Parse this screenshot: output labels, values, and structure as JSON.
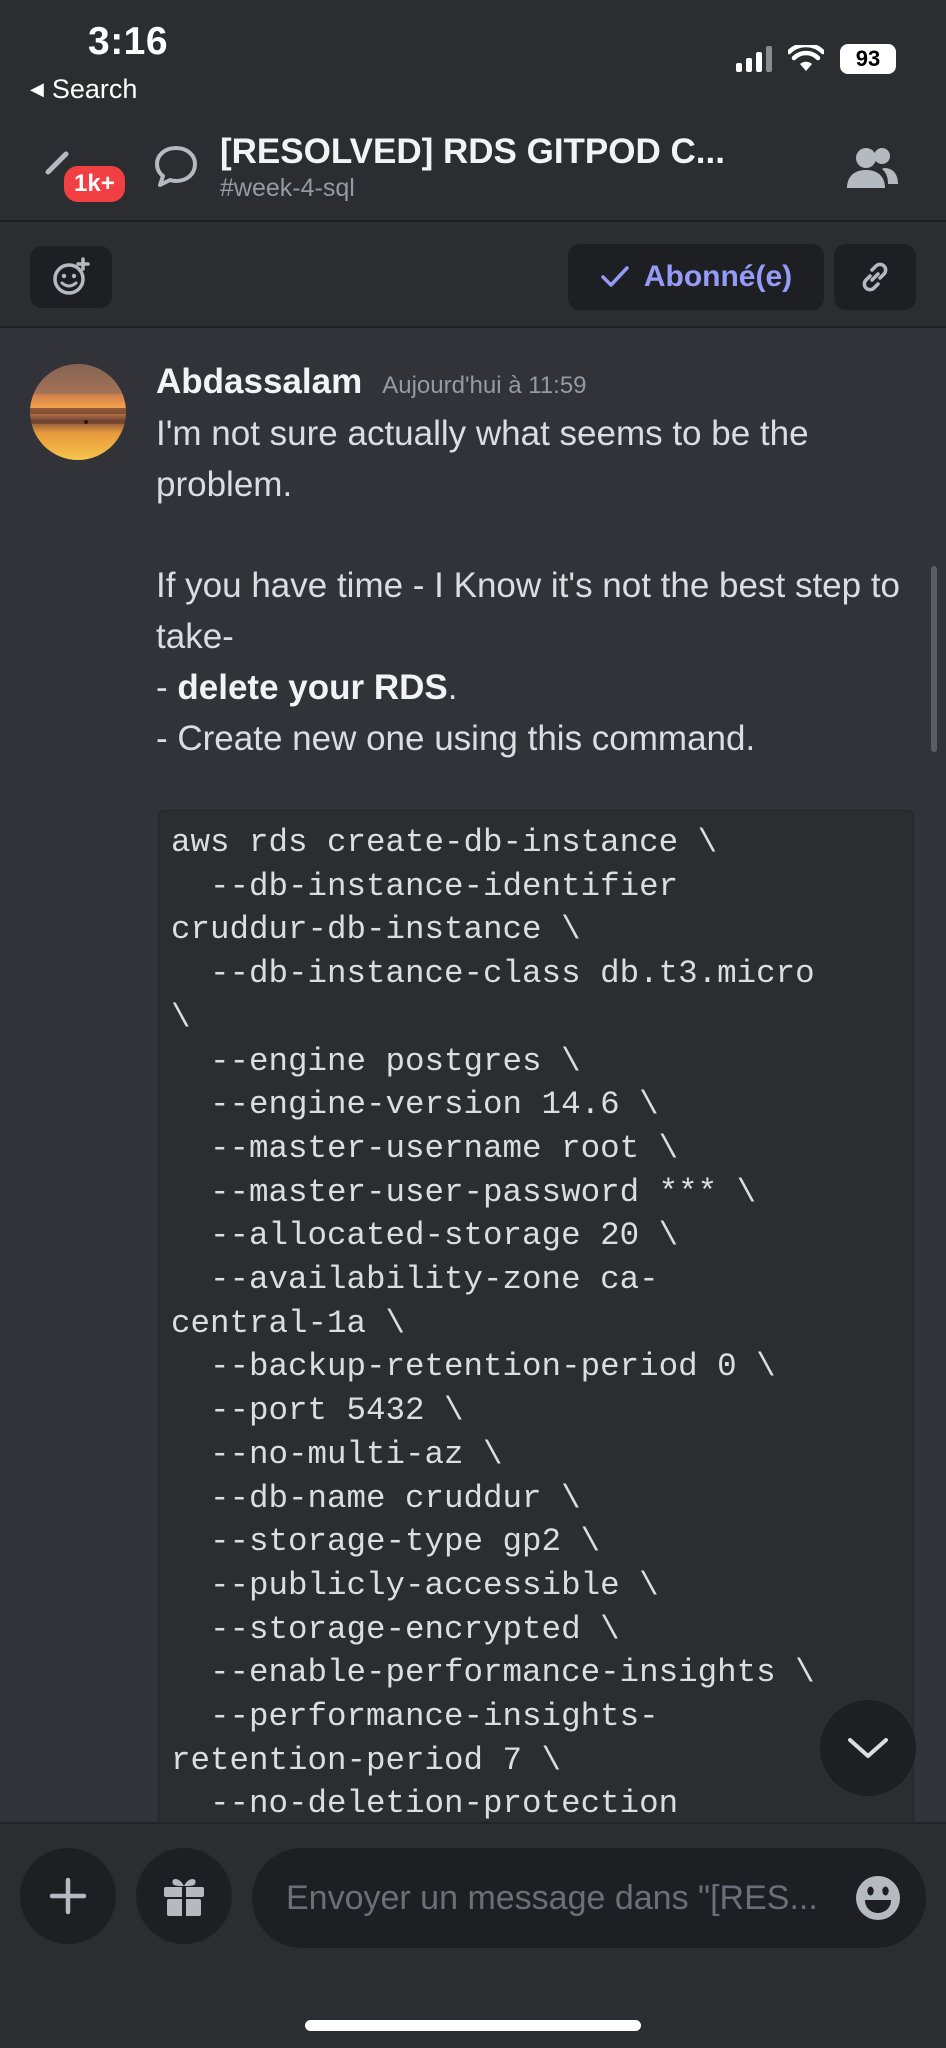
{
  "status_bar": {
    "time": "3:16",
    "back_label": "Search",
    "battery": "93"
  },
  "channel": {
    "title": "[RESOLVED] RDS GITPOD C...",
    "subtitle": "#week-4-sql",
    "badge": "1k+"
  },
  "actions": {
    "follow_label": "Abonné(e)"
  },
  "message": {
    "author": "Abdassalam",
    "timestamp": "Aujourd'hui à 11:59",
    "para1": "I'm not sure actually what seems to be the problem.",
    "para2": "If you have time - I Know it's not the best step to take-",
    "bullet1_prefix": "- ",
    "bullet1_bold": "delete your RDS",
    "bullet1_suffix": ".",
    "bullet2": "- Create new one using this command.",
    "code_lines": [
      "aws rds create-db-instance \\",
      "  --db-instance-identifier",
      "cruddur-db-instance \\",
      "  --db-instance-class db.t3.micro",
      "\\",
      "  --engine postgres \\",
      "  --engine-version 14.6 \\",
      "  --master-username root \\",
      "  --master-user-password *** \\",
      "  --allocated-storage 20 \\",
      "  --availability-zone ca-",
      "central-1a \\",
      "  --backup-retention-period 0 \\",
      "  --port 5432 \\",
      "  --no-multi-az \\",
      "  --db-name cruddur \\",
      "  --storage-type gp2 \\",
      "  --publicly-accessible \\",
      "  --storage-encrypted \\",
      "  --enable-performance-insights \\",
      "  --performance-insights-",
      "retention-period 7 \\",
      "  --no-deletion-protection"
    ]
  },
  "composer": {
    "placeholder": "Envoyer un message dans \"[RES..."
  },
  "colors": {
    "background": "#313338",
    "header": "#2b2d31",
    "accent": "#949cf7",
    "badge": "#f23f43"
  },
  "icons": [
    "back-arrow-icon",
    "signal-icon",
    "wifi-icon",
    "battery-icon",
    "menu-icon",
    "thread-icon",
    "members-icon",
    "add-reaction-icon",
    "checkmark-icon",
    "link-icon",
    "chevron-down-icon",
    "plus-icon",
    "gift-icon",
    "emoji-icon"
  ]
}
